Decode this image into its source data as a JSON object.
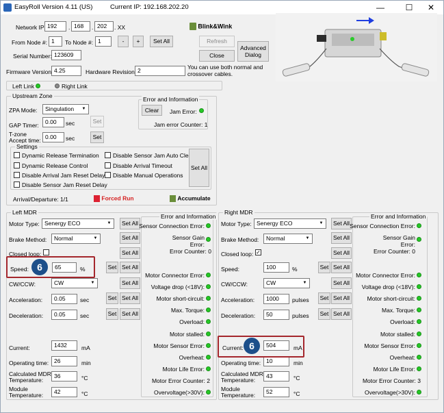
{
  "window": {
    "title": "EasyRoll Version 4.11 (US)",
    "current_ip": "Current IP: 192.168.202.20",
    "minimize": "—",
    "maximize": "☐",
    "close": "✕"
  },
  "top": {
    "network_ip_label": "Network IP:",
    "ip1": "192",
    "ip2": "168",
    "ip3": "202",
    "ip_suffix": ". XX",
    "from_node_label": "From Node #:",
    "from_node": "1",
    "to_node_label": "To Node #:",
    "to_node": "1",
    "minus": "-",
    "plus": "+",
    "set_all": "Set All",
    "serial_label": "Serial Number:",
    "serial": "123609",
    "firmware_label": "Firmware Version:",
    "firmware": "4.25",
    "hardware_label": "Hardware Revision:",
    "hardware": "2",
    "blink_label": "Blink&Wink",
    "refresh": "Refresh",
    "close": "Close",
    "advanced": "Advanced Dialog",
    "note": "You can use both normal and crossover cables."
  },
  "links": {
    "left": "Left Link",
    "right": "Right Link"
  },
  "upstream": {
    "title": "Upstream Zone",
    "zpa_label": "ZPA Mode:",
    "zpa_value": "Singulation",
    "gap_label": "GAP Timer:",
    "gap_value": "0.00",
    "gap_unit": "sec",
    "tzone_label1": "T-zone",
    "tzone_label2": "Accept time:",
    "tzone_value": "0.00",
    "tzone_unit": "sec",
    "set": "Set",
    "error_title": "Error and Information",
    "clear": "Clear",
    "jam_error": "Jam Error:",
    "jam_counter": "Jam error Counter: 1",
    "settings_title": "Settings",
    "settings": [
      "Dynamic Release Termination",
      "Dynamic Release Control",
      "Disable Arrival Jam Reset Delay",
      "Disable Sensor Jam Reset Delay",
      "Disable Sensor Jam Auto Clear",
      "Disable Arrival Timeout",
      "Disable Manual Operations"
    ],
    "settings_set_all": "Set All",
    "arrival": "Arrival/Departure: 1/1",
    "forced_run": "Forced Run",
    "accumulate": "Accumulate"
  },
  "left_mdr": {
    "title": "Left MDR",
    "motor_type_label": "Motor Type:",
    "motor_type": "Senergy ECO",
    "brake_label": "Brake Method:",
    "brake": "Normal",
    "closed_loop_label": "Closed loop:",
    "closed_loop_checked": false,
    "speed_label": "Speed:",
    "speed": "65",
    "speed_unit": "%",
    "cw_label": "CW/CCW:",
    "cw": "CW",
    "accel_label": "Acceleration:",
    "accel": "0.05",
    "accel_unit": "sec",
    "decel_label": "Deceleration:",
    "decel": "0.05",
    "decel_unit": "sec",
    "current_label": "Current:",
    "current": "1432",
    "current_unit": "mA",
    "optime_label": "Operating time:",
    "optime": "26",
    "optime_unit": "min",
    "calc_temp_label1": "Calculated MDR",
    "calc_temp_label2": "Temperature:",
    "calc_temp": "36",
    "calc_temp_unit": "°C",
    "mod_temp_label1": "Module",
    "mod_temp_label2": "Temperature:",
    "mod_temp": "42",
    "mod_temp_unit": "°C",
    "set": "Set",
    "set_all": "Set All",
    "error_title": "Error and Information",
    "sensor_conn": "Sensor Connection Error:",
    "sensor_gain1": "Sensor Gain",
    "sensor_gain2": "Error:",
    "error_counter": "Error Counter: 0",
    "motor_conn": "Motor Connector Error:",
    "voltage_drop": "Voltage drop (<18V):",
    "motor_short": "Motor short-circuit:",
    "max_torque": "Max. Torque:",
    "overload": "Overload:",
    "motor_stalled": "Motor stalled:",
    "motor_sensor": "Motor Sensor Error:",
    "overheat": "Overheat:",
    "motor_life": "Motor Life Error:",
    "motor_err_counter": "Motor Error Counter: 2",
    "overvoltage": "Overvoltage(>30V):"
  },
  "right_mdr": {
    "title": "Right MDR",
    "motor_type_label": "Motor Type:",
    "motor_type": "Senergy ECO",
    "brake_label": "Brake Method:",
    "brake": "Normal",
    "closed_loop_label": "Closed loop:",
    "closed_loop_checked": true,
    "speed_label": "Speed:",
    "speed": "100",
    "speed_unit": "%",
    "cw_label": "CW/CCW:",
    "cw": "CW",
    "accel_label": "Acceleration:",
    "accel": "1000",
    "accel_unit": "pulses",
    "decel_label": "Deceleration:",
    "decel": "50",
    "decel_unit": "pulses",
    "current_label": "Current:",
    "current": "504",
    "current_unit": "mA",
    "optime_label": "Operating time:",
    "optime": "10",
    "optime_unit": "min",
    "calc_temp_label1": "Calculated MDR",
    "calc_temp_label2": "Temperature:",
    "calc_temp": "43",
    "calc_temp_unit": "°C",
    "mod_temp_label1": "Module",
    "mod_temp_label2": "Temperature:",
    "mod_temp": "52",
    "mod_temp_unit": "°C",
    "set": "Set",
    "set_all": "Set All",
    "error_title": "Error and Information",
    "sensor_conn": "Sensor Connection Error:",
    "sensor_gain1": "Sensor Gain",
    "sensor_gain2": "Error:",
    "error_counter": "Error Counter: 0",
    "motor_conn": "Motor Connector Error:",
    "voltage_drop": "Voltage drop (<18V):",
    "motor_short": "Motor short-circuit:",
    "max_torque": "Max. Torque:",
    "overload": "Overload:",
    "motor_stalled": "Motor stalled:",
    "motor_sensor": "Motor Sensor Error:",
    "overheat": "Overheat:",
    "motor_life": "Motor Life Error:",
    "motor_err_counter": "Motor Error Counter: 3",
    "overvoltage": "Overvoltage(>30V):"
  },
  "callouts": {
    "badge_speed": "6",
    "badge_current": "6"
  },
  "colors": {
    "led_ok": "#26c926",
    "highlight": "#a4262c",
    "badge": "#1d4f8a"
  }
}
